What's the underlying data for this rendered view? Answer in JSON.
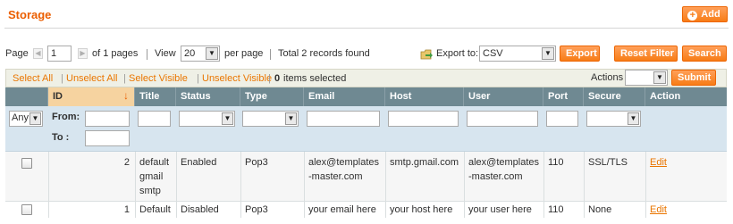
{
  "header": {
    "title": "Storage",
    "add_label": "Add"
  },
  "pager": {
    "page_label": "Page",
    "page_value": "1",
    "of_pages": "of 1 pages",
    "view_label": "View",
    "view_value": "20",
    "per_page": "per page",
    "total": "Total 2 records found",
    "export_label": "Export to:",
    "export_value": "CSV",
    "export_button": "Export",
    "reset_button": "Reset Filter",
    "search_button": "Search"
  },
  "massaction": {
    "select_all": "Select All",
    "unselect_all": "Unselect All",
    "select_visible": "Select Visible",
    "unselect_visible": "Unselect Visible",
    "selected_count": "0",
    "selected_suffix": "items selected",
    "actions_label": "Actions",
    "submit_label": "Submit"
  },
  "grid": {
    "columns": [
      "ID",
      "Title",
      "Status",
      "Type",
      "Email",
      "Host",
      "User",
      "Port",
      "Secure",
      "Action"
    ],
    "sorted_column": "ID",
    "filter": {
      "any_value": "Any",
      "from_label": "From:",
      "to_label": "To :"
    },
    "rows": [
      {
        "id": "2",
        "title": "default gmail smtp",
        "status": "Enabled",
        "type": "Pop3",
        "email": "alex@templates-master.com",
        "host": "smtp.gmail.com",
        "user": "alex@templates-master.com",
        "port": "110",
        "secure": "SSL/TLS",
        "action": "Edit"
      },
      {
        "id": "1",
        "title": "Default",
        "status": "Disabled",
        "type": "Pop3",
        "email": "your email here",
        "host": "your host here",
        "user": "your user here",
        "port": "110",
        "secure": "None",
        "action": "Edit"
      }
    ]
  },
  "colors": {
    "accent": "#eb5e00",
    "header_bg": "#6f8992",
    "filter_bg": "#d7e5ef",
    "link": "#ea7601"
  }
}
